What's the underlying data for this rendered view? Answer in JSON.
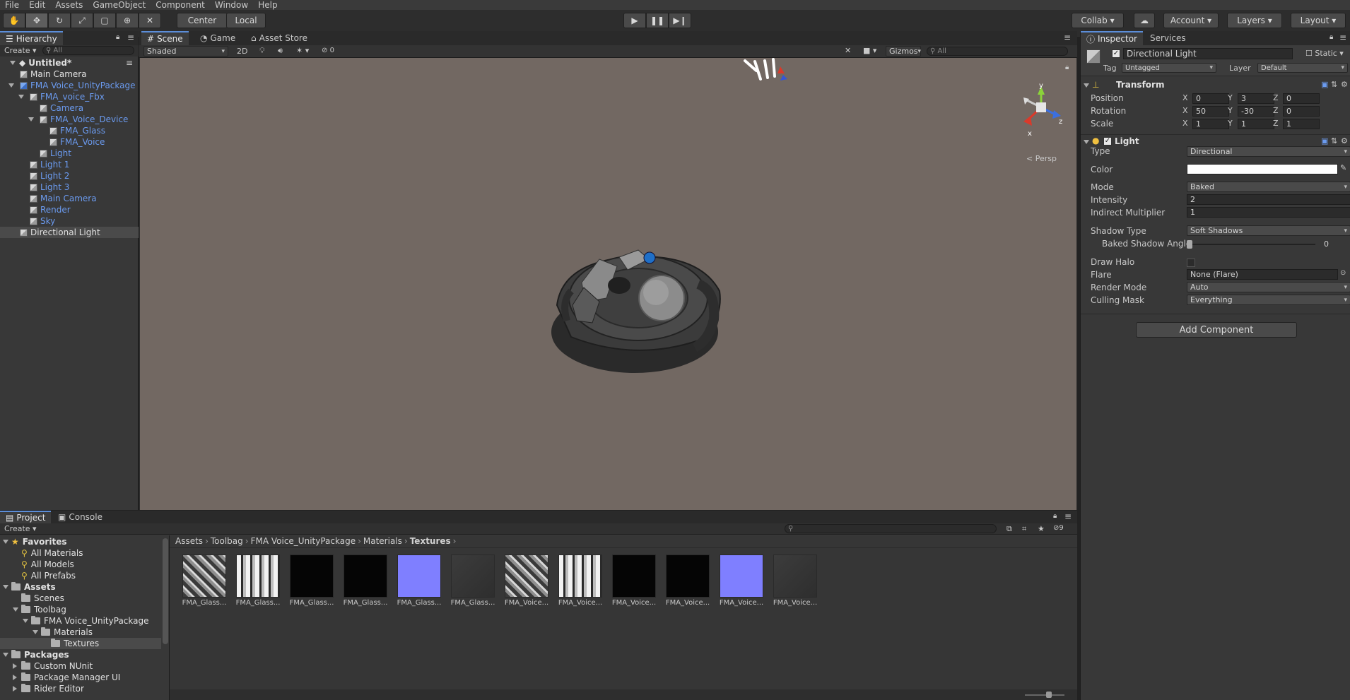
{
  "menu": [
    "File",
    "Edit",
    "Assets",
    "GameObject",
    "Component",
    "Window",
    "Help"
  ],
  "toolbar": {
    "pivot": "Center",
    "space": "Local",
    "collab": "Collab",
    "account": "Account",
    "layers": "Layers",
    "layout": "Layout"
  },
  "hierarchy": {
    "tab": "Hierarchy",
    "create": "Create",
    "search": "All",
    "scene": "Untitled*",
    "items": [
      {
        "label": "Main Camera",
        "depth": 1,
        "color": "white",
        "arrow": ""
      },
      {
        "label": "FMA Voice_UnityPackage",
        "depth": 1,
        "color": "blue",
        "arrow": "down"
      },
      {
        "label": "FMA_voice_Fbx",
        "depth": 2,
        "color": "blue",
        "arrow": "down"
      },
      {
        "label": "Camera",
        "depth": 3,
        "color": "blue",
        "arrow": ""
      },
      {
        "label": "FMA_Voice_Device",
        "depth": 3,
        "color": "blue",
        "arrow": "down"
      },
      {
        "label": "FMA_Glass",
        "depth": 4,
        "color": "blue",
        "arrow": ""
      },
      {
        "label": "FMA_Voice",
        "depth": 4,
        "color": "blue",
        "arrow": ""
      },
      {
        "label": "Light",
        "depth": 3,
        "color": "blue",
        "arrow": ""
      },
      {
        "label": "Light 1",
        "depth": 2,
        "color": "blue",
        "arrow": ""
      },
      {
        "label": "Light 2",
        "depth": 2,
        "color": "blue",
        "arrow": ""
      },
      {
        "label": "Light 3",
        "depth": 2,
        "color": "blue",
        "arrow": ""
      },
      {
        "label": "Main Camera",
        "depth": 2,
        "color": "blue",
        "arrow": ""
      },
      {
        "label": "Render",
        "depth": 2,
        "color": "blue",
        "arrow": ""
      },
      {
        "label": "Sky",
        "depth": 2,
        "color": "blue",
        "arrow": ""
      },
      {
        "label": "Directional Light",
        "depth": 1,
        "color": "white",
        "arrow": "",
        "selected": true
      }
    ]
  },
  "scene": {
    "tabs": [
      "Scene",
      "Game",
      "Asset Store"
    ],
    "shading": "Shaded",
    "mode2d": "2D",
    "hidden_count": "0",
    "gizmos": "Gizmos",
    "search": "All",
    "persp": "Persp"
  },
  "inspector": {
    "tabs": [
      "Inspector",
      "Services"
    ],
    "object_name": "Directional Light",
    "static": "Static",
    "tag_label": "Tag",
    "tag_value": "Untagged",
    "layer_label": "Layer",
    "layer_value": "Default",
    "transform": {
      "title": "Transform",
      "position": {
        "label": "Position",
        "x": "0",
        "y": "3",
        "z": "0"
      },
      "rotation": {
        "label": "Rotation",
        "x": "50",
        "y": "-30",
        "z": "0"
      },
      "scale": {
        "label": "Scale",
        "x": "1",
        "y": "1",
        "z": "1"
      }
    },
    "light": {
      "title": "Light",
      "type_label": "Type",
      "type_value": "Directional",
      "color_label": "Color",
      "color_value": "#ffffff",
      "mode_label": "Mode",
      "mode_value": "Baked",
      "intensity_label": "Intensity",
      "intensity_value": "2",
      "indirect_label": "Indirect Multiplier",
      "indirect_value": "1",
      "shadow_label": "Shadow Type",
      "shadow_value": "Soft Shadows",
      "angle_label": "Baked Shadow Angle",
      "angle_value": "0",
      "halo_label": "Draw Halo",
      "flare_label": "Flare",
      "flare_value": "None (Flare)",
      "render_label": "Render Mode",
      "render_value": "Auto",
      "culling_label": "Culling Mask",
      "culling_value": "Everything"
    },
    "add_component": "Add Component"
  },
  "project": {
    "tabs": [
      "Project",
      "Console"
    ],
    "create": "Create",
    "hidden_count": "9",
    "favorites": "Favorites",
    "fav_items": [
      "All Materials",
      "All Models",
      "All Prefabs"
    ],
    "assets": "Assets",
    "tree": [
      {
        "label": "Scenes",
        "depth": 1
      },
      {
        "label": "Toolbag",
        "depth": 1
      },
      {
        "label": "FMA Voice_UnityPackage",
        "depth": 2
      },
      {
        "label": "Materials",
        "depth": 3
      },
      {
        "label": "Textures",
        "depth": 4,
        "selected": true
      }
    ],
    "packages": "Packages",
    "pkg_items": [
      "Custom NUnit",
      "Package Manager UI",
      "Rider Editor"
    ],
    "breadcrumb": [
      "Assets",
      "Toolbag",
      "FMA Voice_UnityPackage",
      "Materials",
      "Textures"
    ],
    "thumbs": [
      {
        "name": "FMA_Glass...",
        "kind": "albedo"
      },
      {
        "name": "FMA_Glass...",
        "kind": "mask"
      },
      {
        "name": "FMA_Glass...",
        "kind": "black"
      },
      {
        "name": "FMA_Glass...",
        "kind": "black"
      },
      {
        "name": "FMA_Glass...",
        "kind": "normal"
      },
      {
        "name": "FMA_Glass...",
        "kind": "dark"
      },
      {
        "name": "FMA_Voice...",
        "kind": "albedo"
      },
      {
        "name": "FMA_Voice...",
        "kind": "mask"
      },
      {
        "name": "FMA_Voice...",
        "kind": "black"
      },
      {
        "name": "FMA_Voice...",
        "kind": "black"
      },
      {
        "name": "FMA_Voice...",
        "kind": "normal"
      },
      {
        "name": "FMA_Voice...",
        "kind": "dark"
      }
    ]
  },
  "colors": {
    "accent": "#5b8dd9",
    "selection": "#3e5f96",
    "scene_bg": "#726862",
    "link": "#6b9bf0"
  }
}
